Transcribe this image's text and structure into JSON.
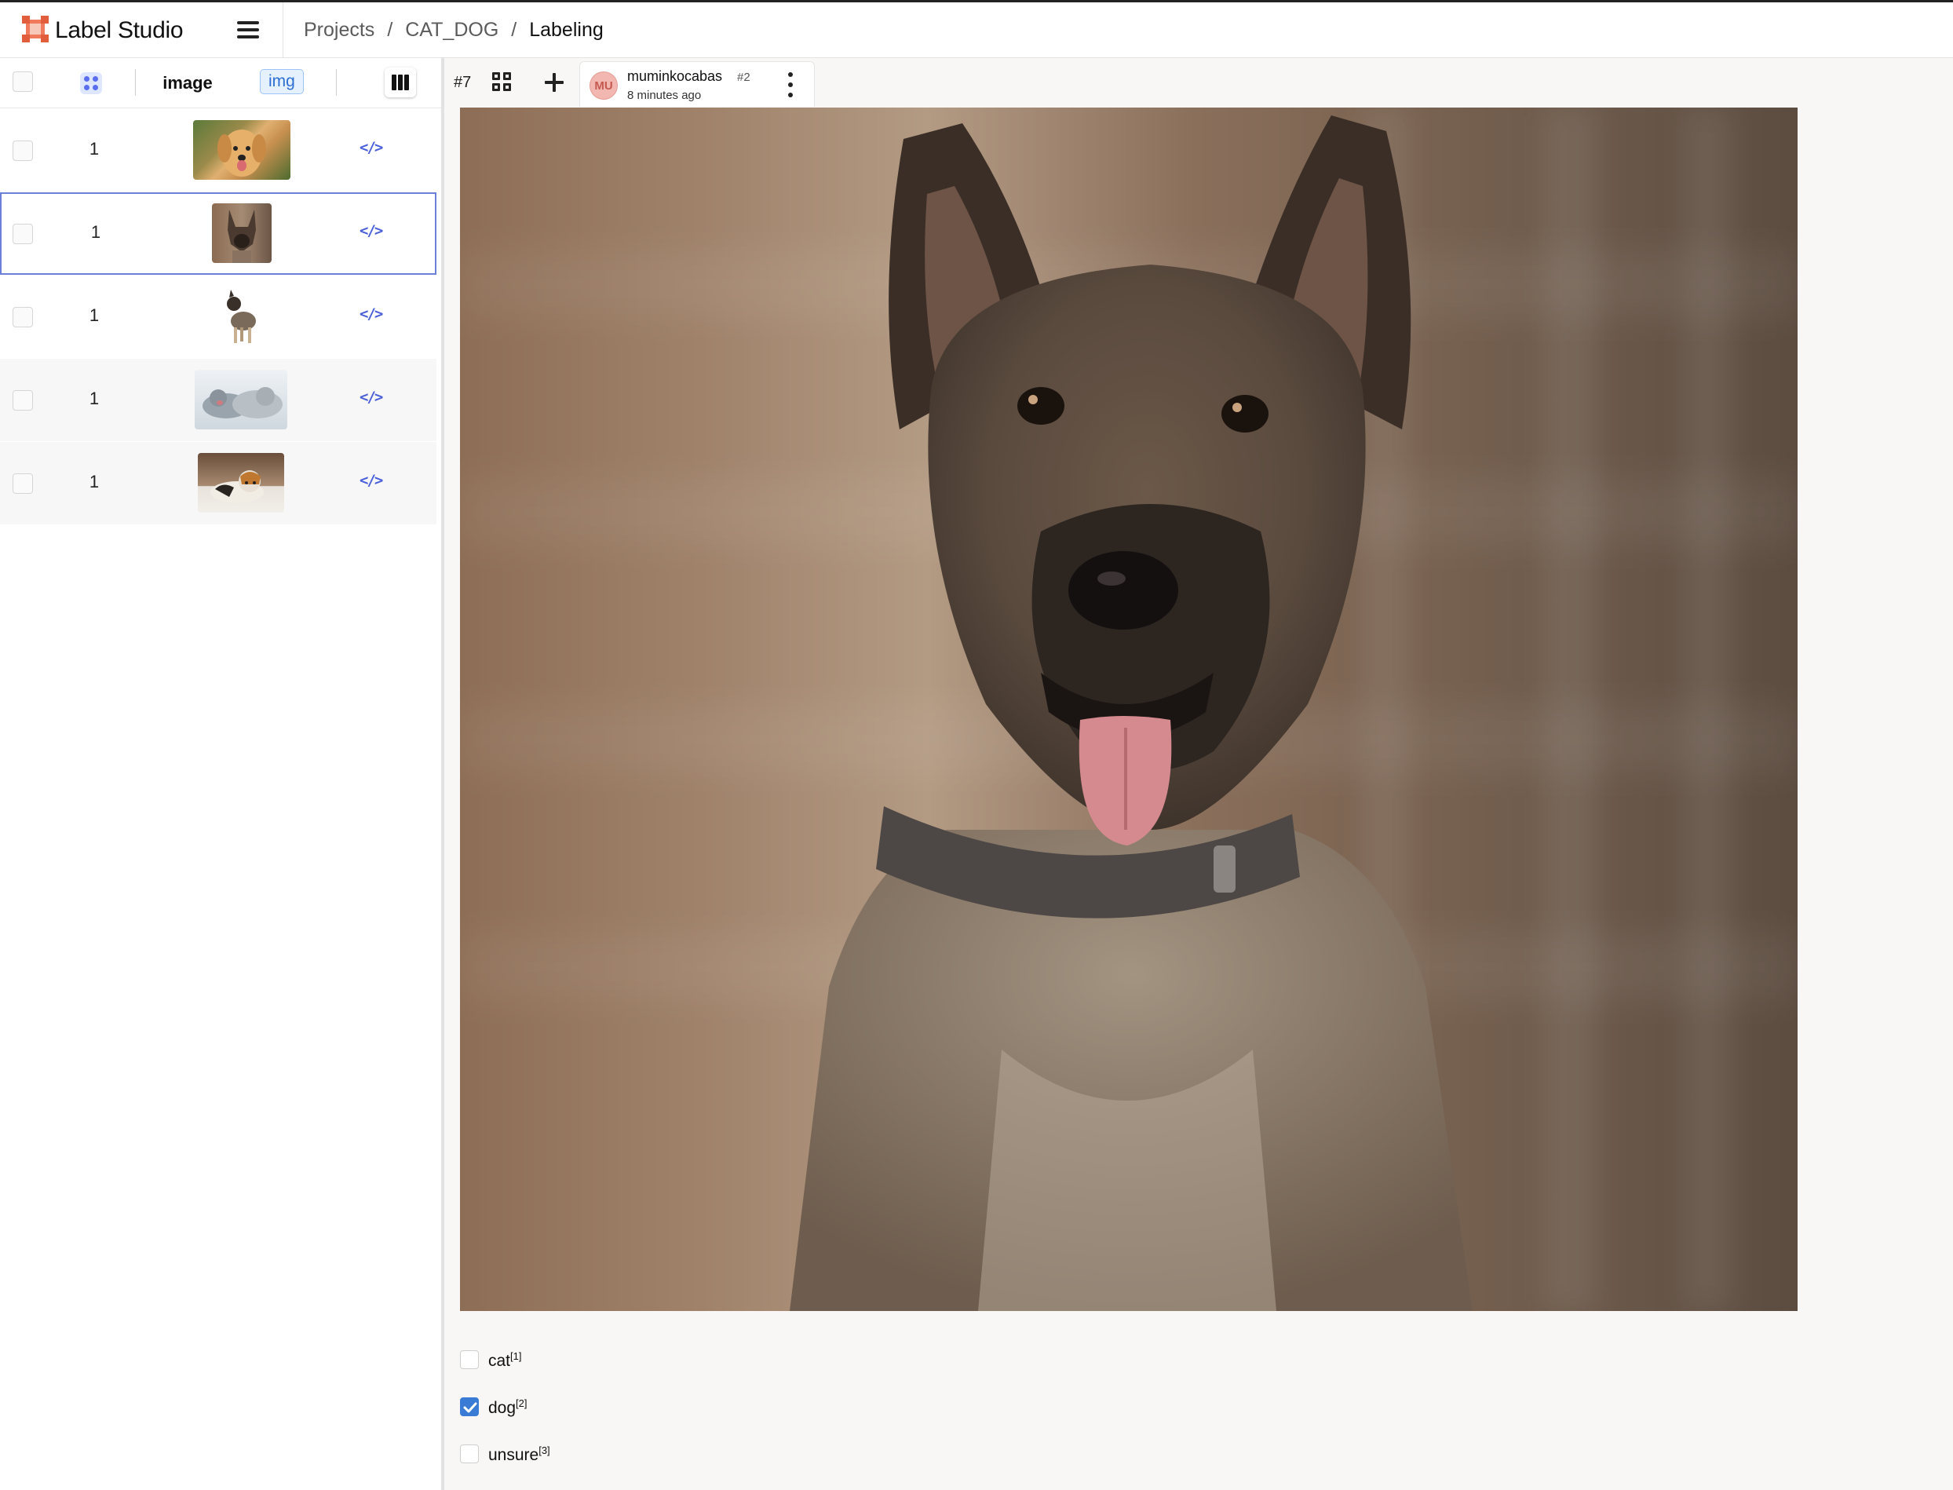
{
  "app": {
    "name": "Label Studio"
  },
  "breadcrumb": {
    "items": [
      "Projects",
      "CAT_DOG",
      "Labeling"
    ],
    "separator": "/"
  },
  "table": {
    "header": {
      "image_column": "image",
      "type_tag": "img"
    },
    "rows": [
      {
        "count": "1",
        "thumbnail": "golden-retriever",
        "selected": false
      },
      {
        "count": "1",
        "thumbnail": "malinois-dog",
        "selected": true
      },
      {
        "count": "1",
        "thumbnail": "terrier-standing",
        "selected": false
      },
      {
        "count": "1",
        "thumbnail": "sleeping-cats",
        "selected": false
      },
      {
        "count": "1",
        "thumbnail": "calico-cat",
        "selected": false
      }
    ],
    "code_icon_text": "</>"
  },
  "annotation": {
    "task_id": "#7",
    "avatar_initials": "MU",
    "user": "muminkocabas",
    "annotation_number": "#2",
    "time": "8 minutes ago"
  },
  "choices": [
    {
      "label": "cat",
      "hotkey": "[1]",
      "checked": false
    },
    {
      "label": "dog",
      "hotkey": "[2]",
      "checked": true
    },
    {
      "label": "unsure",
      "hotkey": "[3]",
      "checked": false
    }
  ],
  "colors": {
    "accent": "#3a7bd5",
    "brand": "#f07a5c",
    "selected_row_border": "#6c7fd9"
  }
}
